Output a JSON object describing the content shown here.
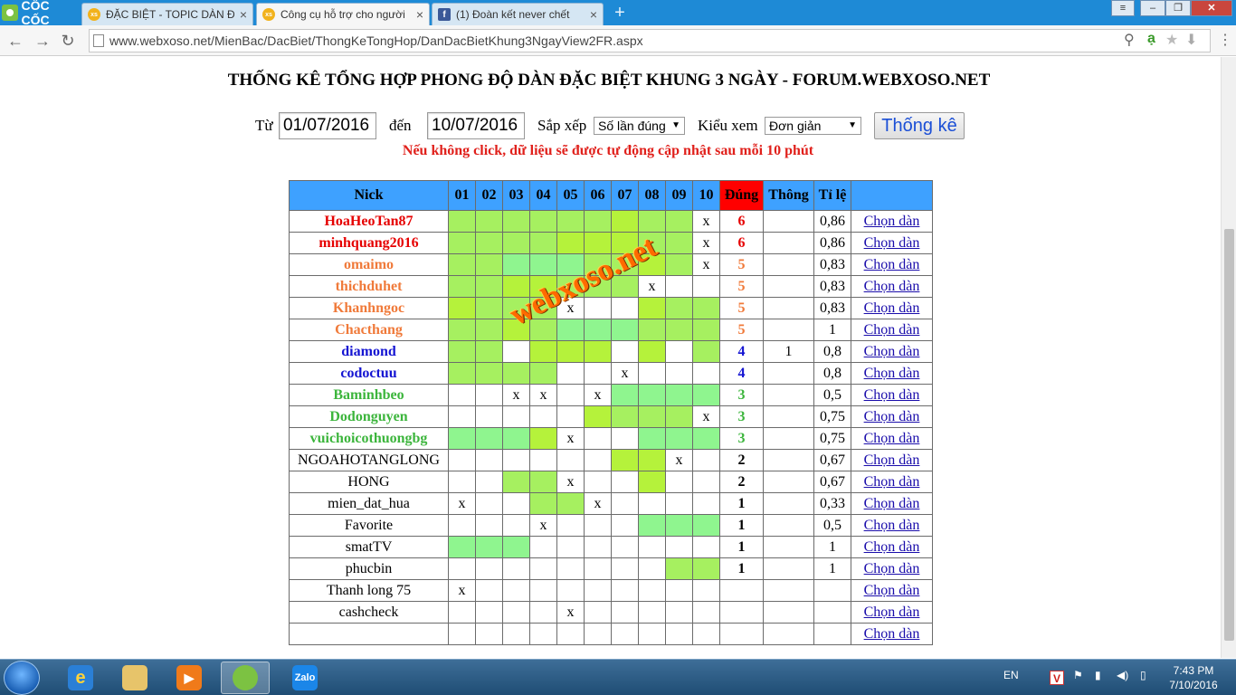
{
  "browser": {
    "logo_text": "CỐC CỐC",
    "tabs": [
      {
        "favicon": "xs",
        "title": "ĐẶC BIỆT - TOPIC DÀN ĐẶ"
      },
      {
        "favicon": "xs",
        "title": "Công cụ hỗ trợ cho người"
      },
      {
        "favicon": "f",
        "title": "(1) Đoàn kết never chết"
      }
    ],
    "new_tab": "+",
    "url": "www.webxoso.net/MienBac/DacBiet/ThongKeTongHop/DanDacBietKhung3NgayView2FR.aspx"
  },
  "page": {
    "title": "THỐNG KÊ TỔNG HỢP PHONG ĐỘ DÀN ĐẶC BIỆT KHUNG 3 NGÀY - FORUM.WEBXOSO.NET",
    "filter": {
      "from_label": "Từ",
      "from_value": "01/07/2016",
      "to_label": "đến",
      "to_value": "10/07/2016",
      "sort_label": "Sắp xếp",
      "sort_value": "Số lần đúng",
      "view_label": "Kiểu xem",
      "view_value": "Đơn giản",
      "submit": "Thống kê"
    },
    "notice": "Nếu không click, dữ liệu sẽ được tự động cập nhật sau mỗi 10 phút",
    "watermark": "webxoso.net"
  },
  "table": {
    "headers": {
      "nick": "Nick",
      "days": [
        "01",
        "02",
        "03",
        "04",
        "05",
        "06",
        "07",
        "08",
        "09",
        "10"
      ],
      "dung": "Đúng",
      "thong": "Thông",
      "tile": "Tỉ lệ"
    },
    "link_label": "Chọn dàn",
    "colors": {
      "red": "#e60000",
      "orange": "#f07a3a",
      "blue": "#1414d2",
      "green": "#3cb53c",
      "black": "#000000",
      "header": "#3ea1ff",
      "dung_header": "#ff0000"
    },
    "rows": [
      {
        "nick": "HoaHeoTan87",
        "color": "red",
        "days": [
          "g1",
          "g1",
          "g1",
          "g1",
          "g1",
          "g1",
          "g2",
          "g1",
          "g1",
          "x"
        ],
        "dung": "6",
        "thong": "",
        "tile": "0,86"
      },
      {
        "nick": "minhquang2016",
        "color": "red",
        "days": [
          "g1",
          "g1",
          "g1",
          "g1",
          "g2",
          "g2",
          "g2",
          "g1",
          "g1",
          "x"
        ],
        "dung": "6",
        "thong": "",
        "tile": "0,86"
      },
      {
        "nick": "omaimo",
        "color": "orange",
        "days": [
          "g1",
          "g1",
          "g3",
          "g3",
          "g3",
          "g1",
          "g1",
          "g2",
          "g1",
          "x"
        ],
        "dung": "5",
        "thong": "",
        "tile": "0,83"
      },
      {
        "nick": "thichduhet",
        "color": "orange",
        "days": [
          "g1",
          "g1",
          "g2",
          "g2",
          "g1",
          "g1",
          "g1",
          "x",
          "",
          ""
        ],
        "dung": "5",
        "thong": "",
        "tile": "0,83"
      },
      {
        "nick": "Khanhngoc",
        "color": "orange",
        "days": [
          "g2",
          "g1",
          "g1",
          "g1",
          "x",
          "",
          "",
          "g2",
          "g1",
          "g1"
        ],
        "dung": "5",
        "thong": "",
        "tile": "0,83"
      },
      {
        "nick": "Chacthang",
        "color": "orange",
        "days": [
          "g1",
          "g1",
          "g2",
          "g1",
          "g3",
          "g3",
          "g3",
          "g1",
          "g1",
          "g1"
        ],
        "dung": "5",
        "thong": "",
        "tile": "1"
      },
      {
        "nick": "diamond",
        "color": "blue",
        "days": [
          "g1",
          "g1",
          "",
          "g2",
          "g2",
          "g2",
          "",
          "g2",
          "",
          "g1"
        ],
        "dung": "4",
        "thong": "1",
        "tile": "0,8"
      },
      {
        "nick": "codoctuu",
        "color": "blue",
        "days": [
          "g1",
          "g1",
          "g1",
          "g1",
          "",
          "",
          "x",
          "",
          "",
          ""
        ],
        "dung": "4",
        "thong": "",
        "tile": "0,8"
      },
      {
        "nick": "Baminhbeo",
        "color": "green",
        "days": [
          "",
          "",
          "x",
          "x",
          "",
          "x",
          "g3",
          "g3",
          "g3",
          "g3"
        ],
        "dung": "3",
        "thong": "",
        "tile": "0,5"
      },
      {
        "nick": "Dodonguyen",
        "color": "green",
        "days": [
          "",
          "",
          "",
          "",
          "",
          "g2",
          "g1",
          "g1",
          "g1",
          "x"
        ],
        "dung": "3",
        "thong": "",
        "tile": "0,75"
      },
      {
        "nick": "vuichoicothuongbg",
        "color": "green",
        "days": [
          "g3",
          "g3",
          "g3",
          "g2",
          "x",
          "",
          "",
          "g3",
          "g3",
          "g3"
        ],
        "dung": "3",
        "thong": "",
        "tile": "0,75"
      },
      {
        "nick": "NGOAHOTANGLONG",
        "color": "black",
        "days": [
          "",
          "",
          "",
          "",
          "",
          "",
          "g2",
          "g2",
          "x",
          ""
        ],
        "dung": "2",
        "thong": "",
        "tile": "0,67"
      },
      {
        "nick": "HONG",
        "color": "black",
        "days": [
          "",
          "",
          "g1",
          "g1",
          "x",
          "",
          "",
          "g2",
          "",
          ""
        ],
        "dung": "2",
        "thong": "",
        "tile": "0,67"
      },
      {
        "nick": "mien_dat_hua",
        "color": "black",
        "days": [
          "x",
          "",
          "",
          "g1",
          "g1",
          "x",
          "",
          "",
          "",
          ""
        ],
        "dung": "1",
        "thong": "",
        "tile": "0,33"
      },
      {
        "nick": "Favorite",
        "color": "black",
        "days": [
          "",
          "",
          "",
          "x",
          "",
          "",
          "",
          "g3",
          "g3",
          "g3"
        ],
        "dung": "1",
        "thong": "",
        "tile": "0,5"
      },
      {
        "nick": "smatTV",
        "color": "black",
        "days": [
          "g3",
          "g3",
          "g3",
          "",
          "",
          "",
          "",
          "",
          "",
          ""
        ],
        "dung": "1",
        "thong": "",
        "tile": "1"
      },
      {
        "nick": "phucbin",
        "color": "black",
        "days": [
          "",
          "",
          "",
          "",
          "",
          "",
          "",
          "",
          "g1",
          "g1"
        ],
        "dung": "1",
        "thong": "",
        "tile": "1"
      },
      {
        "nick": "Thanh long 75",
        "color": "black",
        "days": [
          "x",
          "",
          "",
          "",
          "",
          "",
          "",
          "",
          "",
          ""
        ],
        "dung": "",
        "thong": "",
        "tile": ""
      },
      {
        "nick": "cashcheck",
        "color": "black",
        "days": [
          "",
          "",
          "",
          "",
          "x",
          "",
          "",
          "",
          "",
          ""
        ],
        "dung": "",
        "thong": "",
        "tile": ""
      },
      {
        "nick": "",
        "color": "black",
        "days": [
          "",
          "",
          "",
          "",
          "",
          "",
          "",
          "",
          "",
          ""
        ],
        "dung": "",
        "thong": "",
        "tile": ""
      }
    ]
  },
  "taskbar": {
    "zalo_label": "Zalo",
    "language": "EN",
    "time": "7:43 PM",
    "date": "7/10/2016"
  }
}
